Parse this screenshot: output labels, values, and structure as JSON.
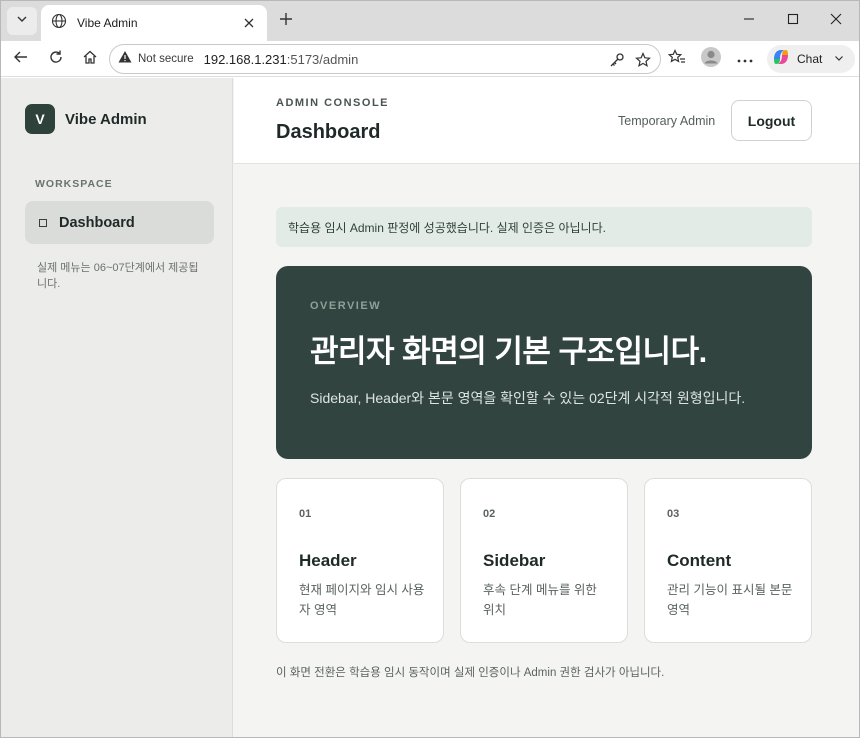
{
  "browser": {
    "tab_title": "Vibe Admin",
    "not_secure": "Not secure",
    "url_host": "192.168.1.231",
    "url_rest": ":5173/admin",
    "chat_label": "Chat"
  },
  "sidebar": {
    "brand_letter": "V",
    "brand_name": "Vibe Admin",
    "section_label": "WORKSPACE",
    "nav_items": [
      {
        "label": "Dashboard",
        "active": true
      }
    ],
    "note": "실제 메뉴는 06~07단계에서 제공됩니다."
  },
  "header": {
    "eyebrow": "ADMIN CONSOLE",
    "title": "Dashboard",
    "user_name": "Temporary Admin",
    "logout_label": "Logout"
  },
  "alert": "학습용 임시 Admin 판정에 성공했습니다. 실제 인증은 아닙니다.",
  "hero": {
    "eyebrow": "OVERVIEW",
    "title": "관리자 화면의 기본 구조입니다.",
    "description": "Sidebar, Header와 본문 영역을 확인할 수 있는 02단계 시각적 원형입니다."
  },
  "cards": [
    {
      "num": "01",
      "title": "Header",
      "desc": "현재 페이지와 임시 사용자 영역"
    },
    {
      "num": "02",
      "title": "Sidebar",
      "desc": "후속 단계 메뉴를 위한 위치"
    },
    {
      "num": "03",
      "title": "Content",
      "desc": "관리 기능이 표시될 본문 영역"
    }
  ],
  "footer_note": "이 화면 전환은 학습용 임시 동작이며 실제 인증이나 Admin 권한 검사가 아닙니다.",
  "colors": {
    "accent_dark": "#324440",
    "brand_logo": "#2f413b",
    "alert_bg": "#e3ebe6"
  },
  "icons": {
    "tab_menu": "chevron-down-icon",
    "favicon": "globe-icon",
    "close": "close-icon",
    "new_tab": "plus-icon",
    "minimize": "minimize-icon",
    "maximize": "maximize-icon",
    "window_close": "close-icon",
    "back": "back-arrow-icon",
    "reload": "reload-icon",
    "home": "home-icon",
    "warning": "warning-icon",
    "key": "key-icon",
    "favorite": "star-icon",
    "favorites": "favorites-icon",
    "profile": "profile-icon",
    "more": "more-icon",
    "copilot": "copilot-icon"
  }
}
